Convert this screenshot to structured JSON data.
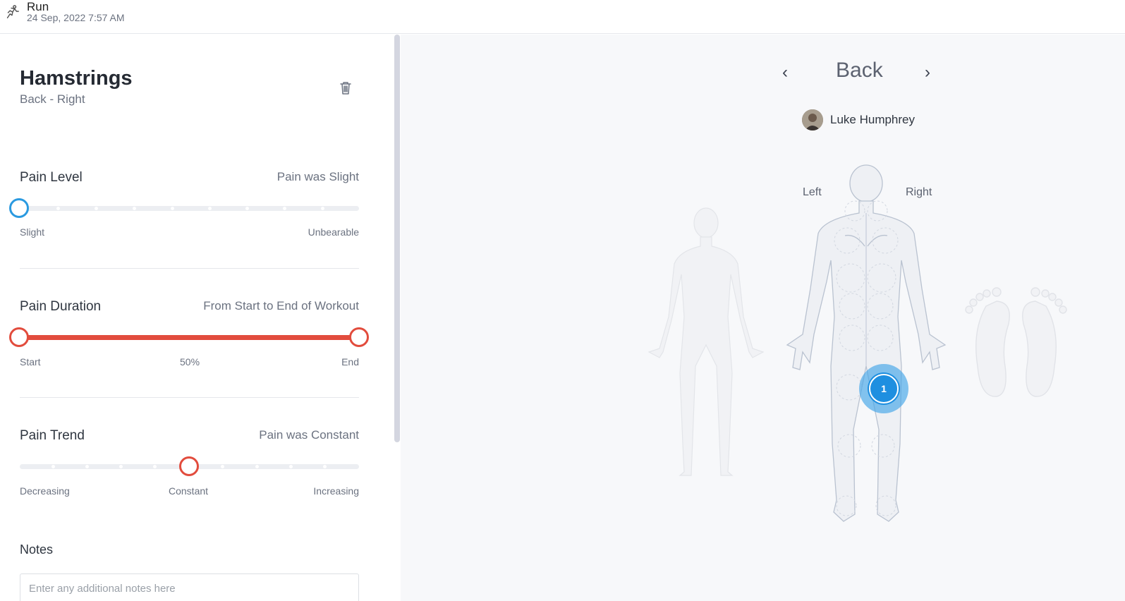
{
  "header": {
    "icon": "run-icon",
    "activity": "Run",
    "date": "24 Sep, 2022 7:57 AM"
  },
  "injury": {
    "title": "Hamstrings",
    "location": "Back - Right",
    "delete_icon": "trash-icon"
  },
  "pain_level": {
    "label": "Pain Level",
    "value_text": "Pain was Slight",
    "min_label": "Slight",
    "max_label": "Unbearable",
    "value": 0,
    "steps": 10
  },
  "pain_duration": {
    "label": "Pain Duration",
    "value_text": "From Start to End of Workout",
    "start_label": "Start",
    "mid_label": "50%",
    "end_label": "End",
    "range": [
      0,
      1
    ]
  },
  "pain_trend": {
    "label": "Pain Trend",
    "value_text": "Pain was Constant",
    "min_label": "Decreasing",
    "mid_label": "Constant",
    "max_label": "Increasing",
    "value": 0.5,
    "steps": 10
  },
  "notes": {
    "label": "Notes",
    "placeholder": "Enter any additional notes here"
  },
  "body_map": {
    "prev_icon": "chevron-left-icon",
    "next_icon": "chevron-right-icon",
    "view": "Back",
    "user_name": "Luke Humphrey",
    "left_label": "Left",
    "right_label": "Right",
    "marker_number": "1"
  },
  "colors": {
    "accent_blue": "#2b9ae0",
    "accent_red": "#e24c3d",
    "marker_blue": "#1e8fe0"
  }
}
